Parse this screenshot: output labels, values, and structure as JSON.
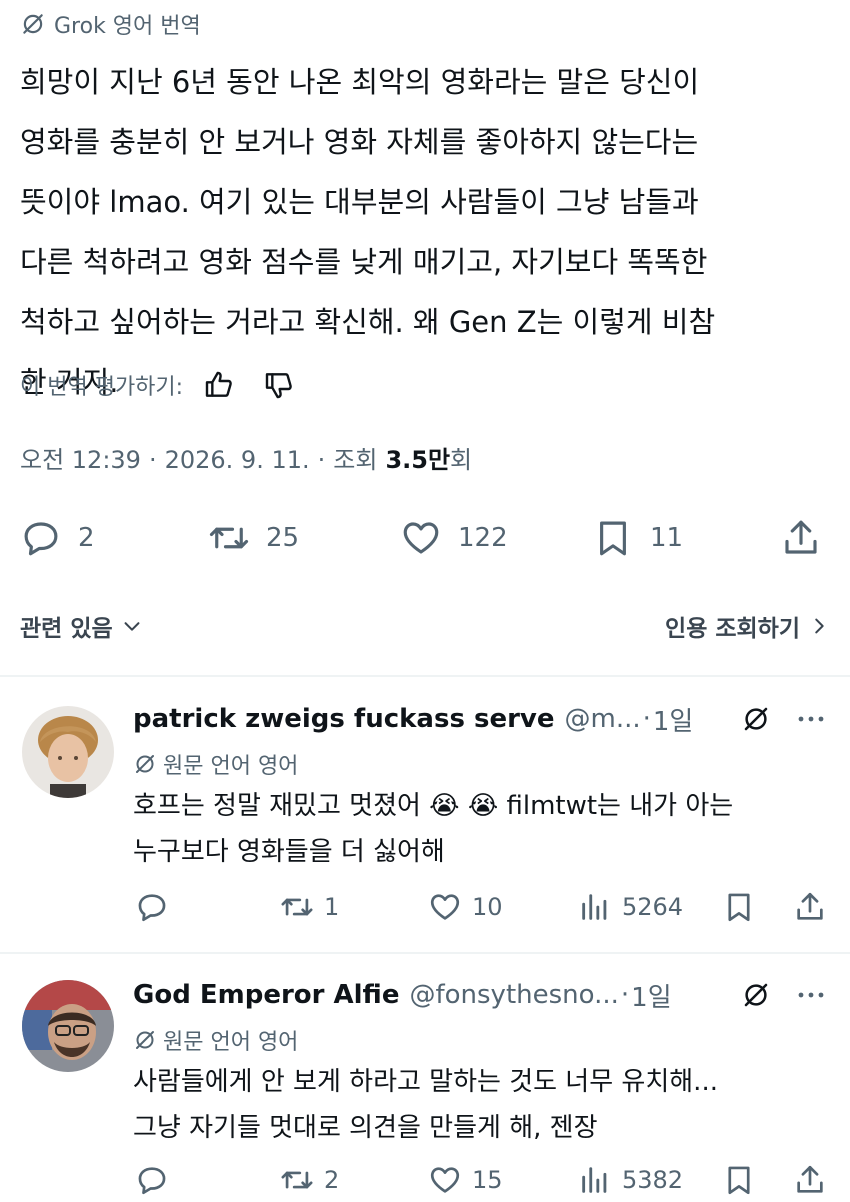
{
  "translation_header": {
    "label": "Grok 영어 번역",
    "icon": "grok-icon"
  },
  "tweet": {
    "lines": [
      "희망이 지난 6년 동안 나온 최악의 영화라는 말은 당신이",
      "영화를 충분히 안 보거나 영화 자체를 좋아하지 않는다는",
      "뜻이야 lmao. 여기 있는 대부분의 사람들이 그냥 남들과",
      "다른 척하려고 영화 점수를 낮게 매기고, 자기보다 똑똑한",
      "척하고 싶어하는 거라고 확신해. 왜 Gen Z는 이렇게 비참",
      "한 거지."
    ]
  },
  "rate": {
    "label": "이 번역 평가하기:"
  },
  "meta": {
    "time": "오전 12:39",
    "sep": "·",
    "date": "2026. 9. 11.",
    "sep2": "·",
    "views_label": "조회",
    "views_value": "3.5만",
    "views_suffix": "회"
  },
  "actions": {
    "replies": "2",
    "reposts": "25",
    "likes": "122",
    "bookmarks": "11"
  },
  "related": {
    "left_label": "관련 있음",
    "right_label": "인용 조회하기"
  },
  "replies": [
    {
      "name": "patrick zweigs fuckass serve",
      "handle": "@m...",
      "dot": "·",
      "time": "1일",
      "orig_lang": "원문 언어 영어",
      "lines": [
        "호프는 정말 재밌고 멋졌어 😭 😭 filmtwt는 내가 아는",
        "누구보다 영화들을 더 싫어해"
      ],
      "replies": "",
      "reposts": "1",
      "likes": "10",
      "views": "5264"
    },
    {
      "name": "God Emperor Alfie",
      "handle": "@fonsythesno...",
      "dot": "·",
      "time": "1일",
      "orig_lang": "원문 언어 영어",
      "lines": [
        "사람들에게 안 보게 하라고 말하는 것도 너무 유치해...",
        "그냥 자기들 멋대로 의견을 만들게 해, 젠장"
      ],
      "replies": "",
      "reposts": "2",
      "likes": "15",
      "views": "5382"
    }
  ],
  "colors": {
    "text": "#0f1419",
    "secondary": "#536471",
    "divider": "#eff3f4"
  }
}
